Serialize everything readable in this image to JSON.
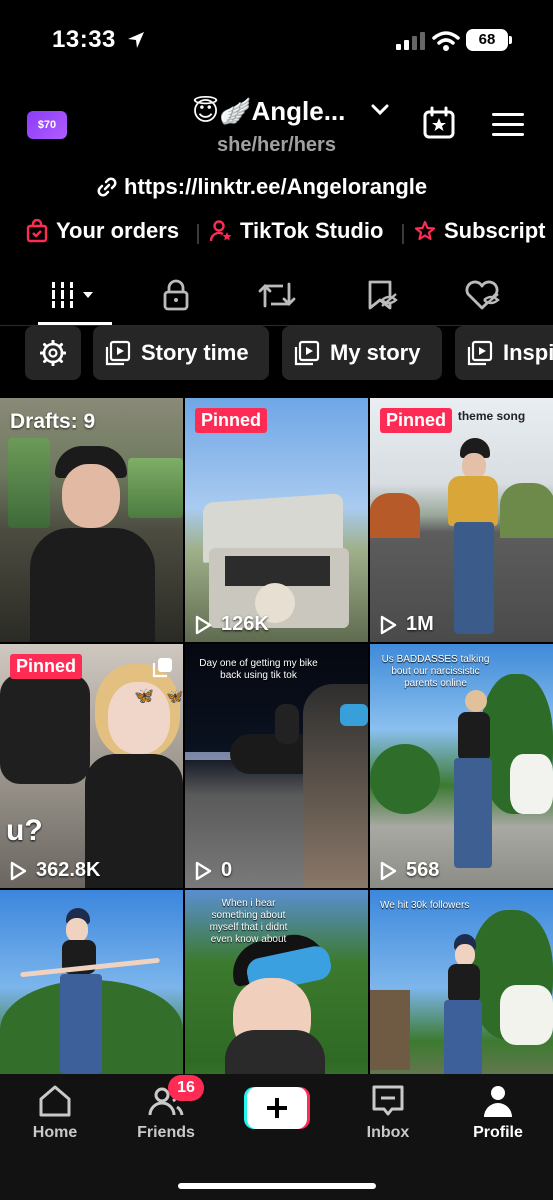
{
  "status": {
    "time": "13:33",
    "battery": "68"
  },
  "header": {
    "coins": "$70",
    "title": "😇🪽Angle...",
    "pronouns": "she/her/hers",
    "link": "https://linktr.ee/Angelorangle"
  },
  "quick_links": [
    {
      "label": "Your orders",
      "icon": "shopping-bag-icon"
    },
    {
      "label": "TikTok Studio",
      "icon": "person-star-icon"
    },
    {
      "label": "Subscript",
      "icon": "subscription-icon"
    }
  ],
  "tabs": [
    {
      "name": "videos",
      "icon": "grid-icon",
      "active": true
    },
    {
      "name": "private",
      "icon": "lock-icon"
    },
    {
      "name": "reposts",
      "icon": "repost-icon"
    },
    {
      "name": "favorites",
      "icon": "bookmark-hidden-icon"
    },
    {
      "name": "liked",
      "icon": "heart-hidden-icon"
    }
  ],
  "chips": [
    {
      "label": ""
    },
    {
      "label": "Story time"
    },
    {
      "label": "My story"
    },
    {
      "label": "Inspi"
    }
  ],
  "videos": [
    {
      "label": "Drafts: 9",
      "views": ""
    },
    {
      "badge": "Pinned",
      "views": "126K"
    },
    {
      "badge": "Pinned",
      "views": "1M",
      "caption": "theme song"
    },
    {
      "badge": "Pinned",
      "views": "362.8K",
      "overlay": "u?"
    },
    {
      "views": "0",
      "caption": "Day one of getting my bike back using tik tok"
    },
    {
      "views": "568",
      "caption": "Us BADDASSES talking bout our narcissistic parents online"
    },
    {
      "views": ""
    },
    {
      "views": "",
      "caption": "When i hear something about myself that i didnt even know about"
    },
    {
      "views": "",
      "caption": "We hit 30k followers"
    }
  ],
  "nav": {
    "home": "Home",
    "friends": "Friends",
    "friends_badge": "16",
    "inbox": "Inbox",
    "profile": "Profile"
  },
  "colors": {
    "accent": "#fe2c55",
    "background": "#000000",
    "chip_bg": "#262626",
    "coin_purple": "#8a3cf7"
  }
}
